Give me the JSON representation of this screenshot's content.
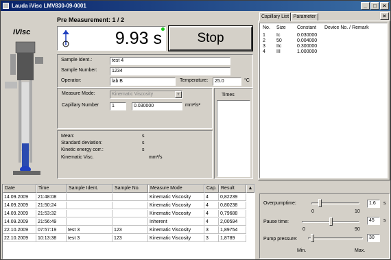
{
  "window": {
    "title": "Lauda iVisc   LMV830-09-0001"
  },
  "brand": {
    "name": "iVisc"
  },
  "measurement": {
    "heading": "Pre Measurement: 1 / 2",
    "time_value": "9.93 s",
    "stop_label": "Stop"
  },
  "sample": {
    "ident_label": "Sample Ident.:",
    "ident_value": "test 4",
    "number_label": "Sample Number:",
    "number_value": "1234",
    "operator_label": "Operator:",
    "operator_value": "lab B",
    "temperature_label": "Temperature:",
    "temperature_value": "25.0",
    "temperature_unit": "°C"
  },
  "mode": {
    "measure_mode_label": "Measure Mode:",
    "measure_mode_value": "Kinematic Viscosity",
    "capillary_label": "Capillary Number",
    "capillary_number": "1",
    "capillary_constant": "0.030000",
    "capillary_unit": "mm²/s²",
    "times_label": "Times"
  },
  "results": {
    "mean_label": "Mean:",
    "mean_unit": "s",
    "std_label": "Standard deviation:",
    "std_unit": "s",
    "kinetic_label": "Kinetic energy corr.:",
    "kinetic_unit": "s",
    "kvisc_label": "Kinematic Visc.",
    "kvisc_unit": "mm²/s"
  },
  "history": {
    "columns": [
      "Date",
      "Time",
      "Sample Ident.",
      "Sample No.",
      "Measure Mode",
      "Cap.",
      "Result"
    ],
    "rows": [
      [
        "14.09.2009",
        "21:48:08",
        "",
        "",
        "Kinematic Viscosity",
        "4",
        "0,82239"
      ],
      [
        "14.09.2009",
        "21:50:24",
        "",
        "",
        "Kinematic Viscosity",
        "4",
        "0,80238"
      ],
      [
        "14.09.2009",
        "21:53:32",
        "",
        "",
        "Kinematic Viscosity",
        "4",
        "0,79688"
      ],
      [
        "14.09.2009",
        "21:56:49",
        "",
        "",
        "Inherent",
        "4",
        "2,00594"
      ],
      [
        "22.10.2009",
        "07:57:19",
        "test 3",
        "123",
        "Kinematic Viscosity",
        "3",
        "1,89754"
      ],
      [
        "22.10.2009",
        "10:13:38",
        "test 3",
        "123",
        "Kinematic Viscosity",
        "3",
        "1,8789"
      ]
    ]
  },
  "tabs": {
    "capillary_list": "Capillary List",
    "parameter": "Parameter"
  },
  "capillaries": {
    "columns": [
      "No.",
      "Size",
      "Constant",
      "Device No. / Remark"
    ],
    "rows": [
      [
        "1",
        "Ic",
        "0.030000",
        ""
      ],
      [
        "2",
        "50",
        "0.004000",
        ""
      ],
      [
        "3",
        "IIc",
        "0.300000",
        ""
      ],
      [
        "4",
        "III",
        "1.000000",
        ""
      ]
    ]
  },
  "controls": {
    "overpump_label": "Overpumptime:",
    "overpump_value": "1.6",
    "overpump_unit": "s",
    "overpump_min": "0",
    "overpump_max": "10",
    "overpump_level": 0.16,
    "pause_label": "Pause time:",
    "pause_value": "45",
    "pause_unit": "s",
    "pause_min": "0",
    "pause_max": "90",
    "pause_level": 0.5,
    "pump_label": "Pump pressure:",
    "pump_value": "30",
    "pump_min": "Min.",
    "pump_max": "Max.",
    "pump_level": 0.05
  },
  "colors": {
    "title_bar": "#0a246a",
    "led_green": "#18c818",
    "accent_blue": "#1f3fbf"
  }
}
